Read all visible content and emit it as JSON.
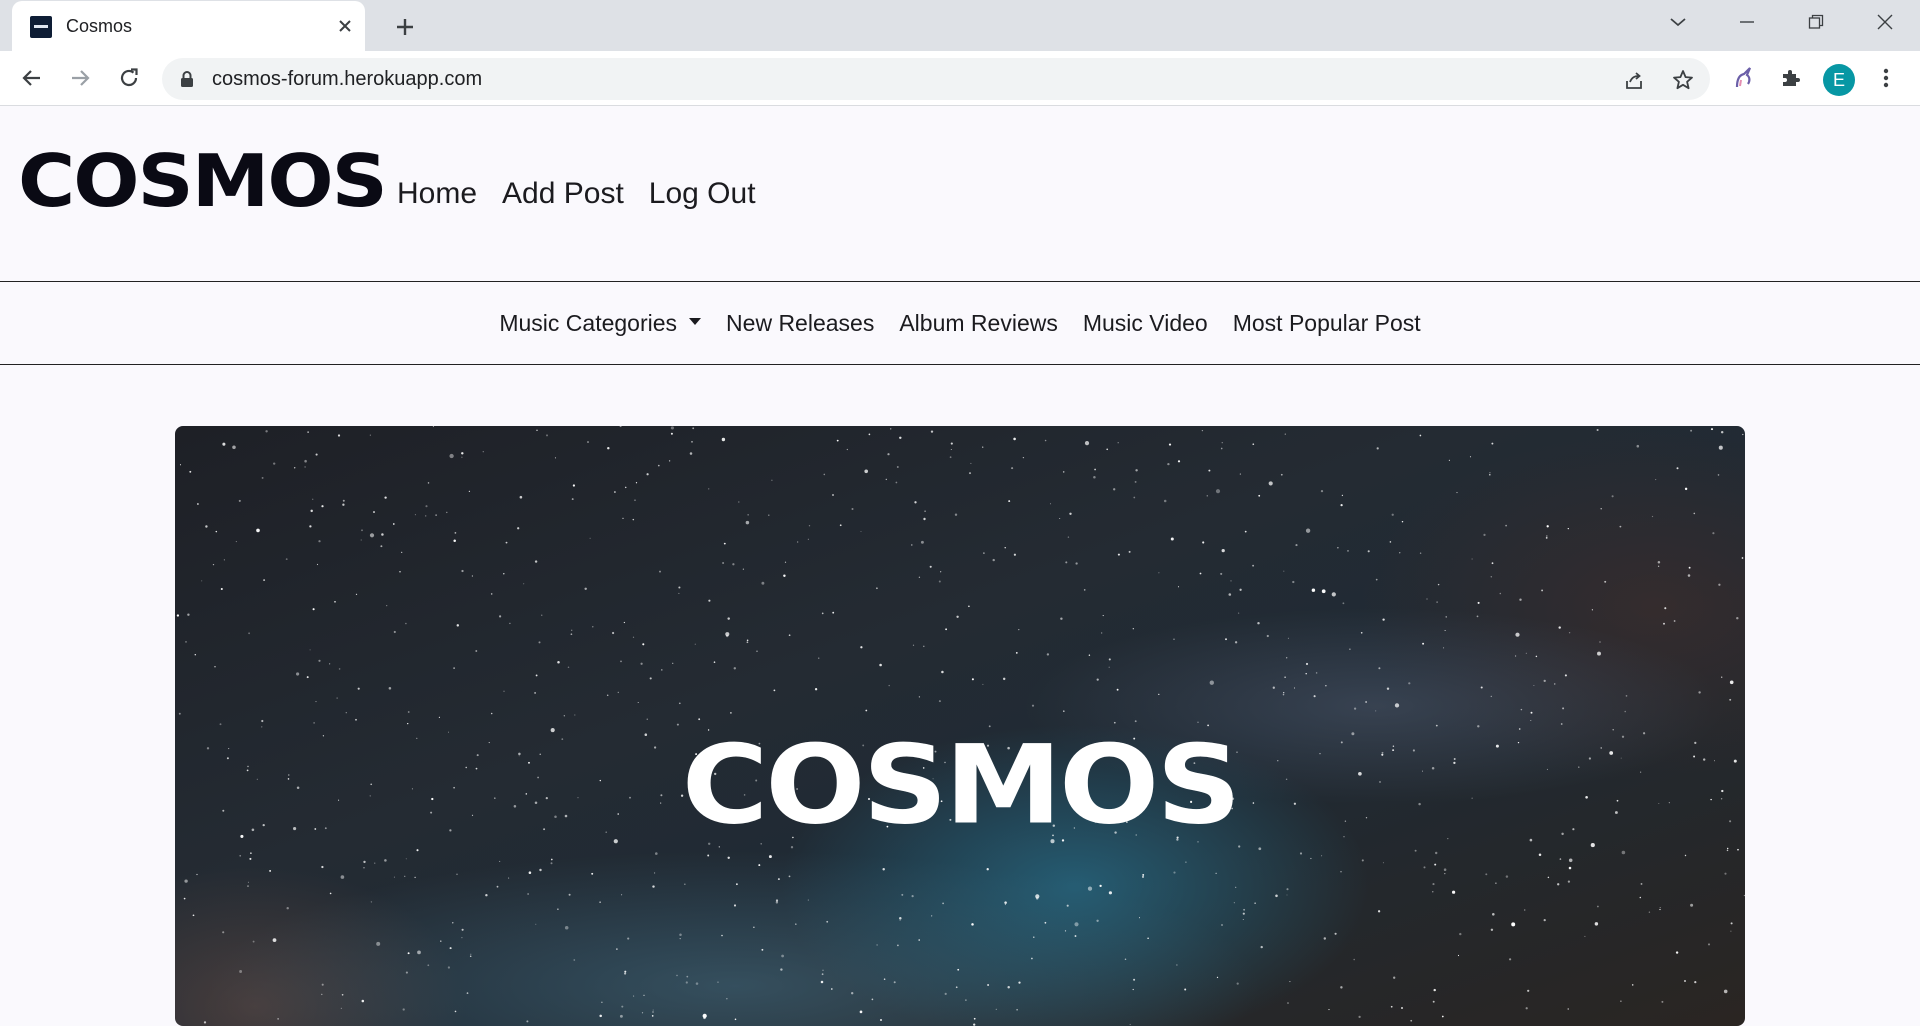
{
  "browser": {
    "tab": {
      "title": "Cosmos"
    },
    "address_bar": {
      "url": "cosmos-forum.herokuapp.com"
    },
    "profile_initial": "E",
    "icons": [
      "back-icon",
      "forward-icon",
      "reload-icon",
      "lock-icon",
      "share-icon",
      "bookmark-star-icon",
      "unicorn-extension-icon",
      "extensions-puzzle-icon",
      "kebab-menu-icon",
      "tab-search-chevron-icon",
      "minimize-icon",
      "restore-icon",
      "close-window-icon"
    ]
  },
  "header": {
    "logo": "COSMOS",
    "nav": [
      {
        "label": "Home"
      },
      {
        "label": "Add Post"
      },
      {
        "label": "Log Out"
      }
    ]
  },
  "category_bar": {
    "items": [
      {
        "label": "Music Categories",
        "dropdown": true
      },
      {
        "label": "New Releases"
      },
      {
        "label": "Album Reviews"
      },
      {
        "label": "Music Video"
      },
      {
        "label": "Most Popular Post"
      }
    ]
  },
  "hero": {
    "title": "COSMOS"
  },
  "colors": {
    "page_bg": "#faf9fd",
    "tabstrip_bg": "#dee1e6",
    "avatar_bg": "#0797a4",
    "text": "#1b1b1f"
  }
}
